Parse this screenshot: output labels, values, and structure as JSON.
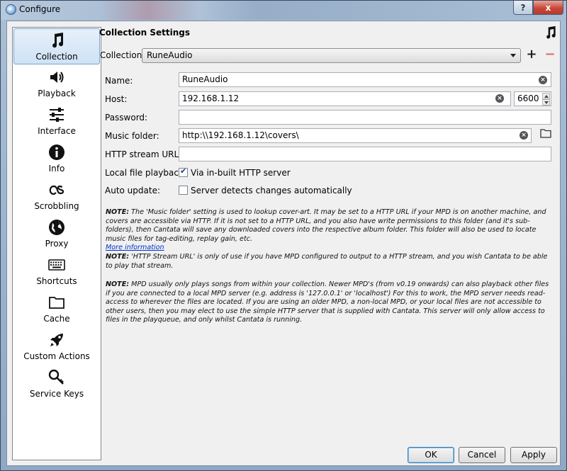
{
  "window": {
    "title": "Configure",
    "help": "?",
    "close": "x"
  },
  "sidebar": {
    "items": [
      {
        "label": "Collection",
        "icon": "music-note-icon",
        "selected": true
      },
      {
        "label": "Playback",
        "icon": "speaker-icon"
      },
      {
        "label": "Interface",
        "icon": "sliders-icon"
      },
      {
        "label": "Info",
        "icon": "info-icon"
      },
      {
        "label": "Scrobbling",
        "icon": "lastfm-icon"
      },
      {
        "label": "Proxy",
        "icon": "globe-icon"
      },
      {
        "label": "Shortcuts",
        "icon": "keyboard-icon"
      },
      {
        "label": "Cache",
        "icon": "folder-icon"
      },
      {
        "label": "Custom Actions",
        "icon": "rocket-icon"
      },
      {
        "label": "Service Keys",
        "icon": "key-icon"
      }
    ]
  },
  "panel": {
    "title": "Collection Settings"
  },
  "collection": {
    "label": "Collection:",
    "value": "RuneAudio",
    "add": "+",
    "remove": "−"
  },
  "form": {
    "name_label": "Name:",
    "name_value": "RuneAudio",
    "host_label": "Host:",
    "host_value": "192.168.1.12",
    "port_value": "6600",
    "password_label": "Password:",
    "password_value": "",
    "music_folder_label": "Music folder:",
    "music_folder_value": "http:\\\\192.168.1.12\\covers\\",
    "http_stream_label": "HTTP stream URL:",
    "http_stream_value": "",
    "local_playback_label": "Local file playback:",
    "local_playback_text": "Via in-built HTTP server",
    "local_playback_checked": true,
    "auto_update_label": "Auto update:",
    "auto_update_text": "Server detects changes automatically",
    "auto_update_checked": false
  },
  "notes": {
    "note_prefix": "NOTE:",
    "note1": " The 'Music folder' setting is used to lookup cover-art. It may be set to a HTTP URL if your MPD is on another machine, and covers are accessible via HTTP. If it is not set to a HTTP URL, and you also have write permissions to this folder (and it's sub-folders), then Cantata will save any downloaded covers into the respective album folder. This folder will also be used to locate music files for tag-editing, replay gain, etc.",
    "more_info": "More information",
    "note2": " 'HTTP Stream URL' is only of use if you have MPD configured to output to a HTTP stream, and you wish Cantata to be able to play that stream.",
    "note3": " MPD usually only plays songs from within your collection. Newer MPD's (from v0.19 onwards) can also playback other files if you are connected to a local MPD server (e.g. address is '127.0.0.1' or 'localhost') For this to work, the MPD server needs read-access to wherever the files are located. If you are using an older MPD, a non-local MPD, or your local files are not accessible to other users, then you may elect to use the simple HTTP server that is supplied with Cantata. This server will only allow access to files in the playqueue, and only whilst Cantata is running."
  },
  "buttons": {
    "ok": "OK",
    "cancel": "Cancel",
    "apply": "Apply"
  }
}
